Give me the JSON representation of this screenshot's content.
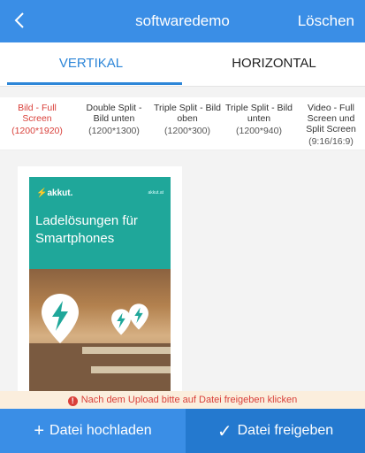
{
  "header": {
    "title": "softwaredemo",
    "delete_label": "Löschen"
  },
  "tabs": [
    {
      "label": "VERTIKAL",
      "active": true
    },
    {
      "label": "HORIZONTAL",
      "active": false
    }
  ],
  "formats": [
    {
      "name": "Bild - Full Screen",
      "size": "(1200*1920)",
      "active": true
    },
    {
      "name": "Double Split - Bild unten",
      "size": "(1200*1300)",
      "active": false
    },
    {
      "name": "Triple Split - Bild oben",
      "size": "(1200*300)",
      "active": false
    },
    {
      "name": "Triple Split - Bild unten",
      "size": "(1200*940)",
      "active": false
    },
    {
      "name": "Video - Full Screen und Split Screen",
      "size": "(9:16/16:9)",
      "active": false
    }
  ],
  "poster": {
    "logo": "akkut.",
    "url": "akkut.at",
    "headline": "Ladelösungen für Smartphones"
  },
  "notice": {
    "text": "Nach dem Upload bitte auf Datei freigeben klicken"
  },
  "actions": {
    "upload_label": "Datei hochladen",
    "share_label": "Datei freigeben"
  },
  "colors": {
    "primary": "#3a8ee6",
    "primary_dark": "#2479cf",
    "accent": "#d9403a",
    "notice_bg": "#fbeedd"
  }
}
